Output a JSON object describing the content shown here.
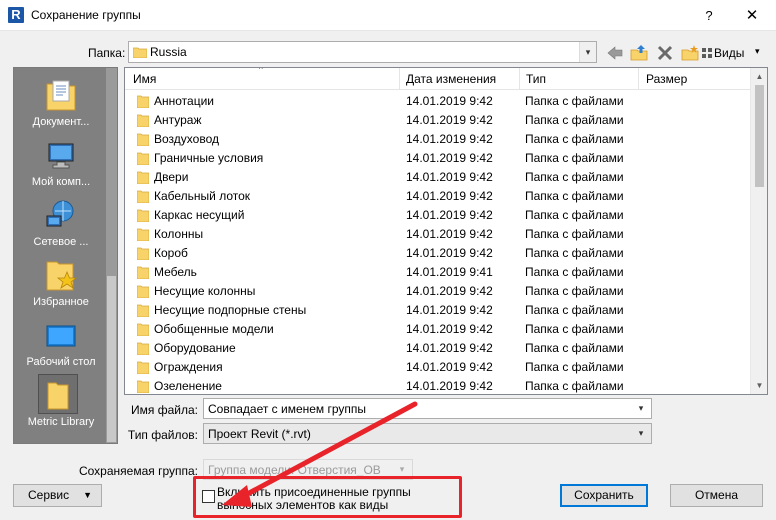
{
  "window": {
    "app_icon_letter": "R",
    "title": "Сохранение группы",
    "help_label": "?",
    "close_label": "✕"
  },
  "toolbar": {
    "folder_label": "Папка:",
    "folder_value": "Russia",
    "views_label": "Виды",
    "icons": [
      "back-arrow-icon",
      "up-folder-icon",
      "delete-icon",
      "new-folder-icon",
      "views-icon"
    ]
  },
  "places": [
    {
      "label": "Документ...",
      "icon": "documents-icon"
    },
    {
      "label": "Мой комп...",
      "icon": "computer-icon"
    },
    {
      "label": "Сетевое ...",
      "icon": "network-icon"
    },
    {
      "label": "Избранное",
      "icon": "favorites-icon"
    },
    {
      "label": "Рабочий стол",
      "icon": "desktop-icon"
    },
    {
      "label": "Metric Library",
      "icon": "library-folder-icon"
    }
  ],
  "columns": {
    "name": "Имя",
    "date": "Дата изменения",
    "type": "Тип",
    "size": "Размер"
  },
  "files": [
    {
      "name": "Аннотации",
      "date": "14.01.2019 9:42",
      "type": "Папка с файлами"
    },
    {
      "name": "Антураж",
      "date": "14.01.2019 9:42",
      "type": "Папка с файлами"
    },
    {
      "name": "Воздуховод",
      "date": "14.01.2019 9:42",
      "type": "Папка с файлами"
    },
    {
      "name": "Граничные условия",
      "date": "14.01.2019 9:42",
      "type": "Папка с файлами"
    },
    {
      "name": "Двери",
      "date": "14.01.2019 9:42",
      "type": "Папка с файлами"
    },
    {
      "name": "Кабельный лоток",
      "date": "14.01.2019 9:42",
      "type": "Папка с файлами"
    },
    {
      "name": "Каркас несущий",
      "date": "14.01.2019 9:42",
      "type": "Папка с файлами"
    },
    {
      "name": "Колонны",
      "date": "14.01.2019 9:42",
      "type": "Папка с файлами"
    },
    {
      "name": "Короб",
      "date": "14.01.2019 9:42",
      "type": "Папка с файлами"
    },
    {
      "name": "Мебель",
      "date": "14.01.2019 9:41",
      "type": "Папка с файлами"
    },
    {
      "name": "Несущие колонны",
      "date": "14.01.2019 9:42",
      "type": "Папка с файлами"
    },
    {
      "name": "Несущие подпорные стены",
      "date": "14.01.2019 9:42",
      "type": "Папка с файлами"
    },
    {
      "name": "Обобщенные модели",
      "date": "14.01.2019 9:42",
      "type": "Папка с файлами"
    },
    {
      "name": "Оборудование",
      "date": "14.01.2019 9:42",
      "type": "Папка с файлами"
    },
    {
      "name": "Ограждения",
      "date": "14.01.2019 9:42",
      "type": "Папка с файлами"
    },
    {
      "name": "Озеленение",
      "date": "14.01.2019 9:42",
      "type": "Папка с файлами"
    }
  ],
  "form": {
    "filename_label": "Имя файла:",
    "filename_value": "Совпадает с именем группы",
    "filetype_label": "Тип файлов:",
    "filetype_value": "Проект Revit  (*.rvt)",
    "group_label": "Сохраняемая группа:",
    "group_value": "Группа модели: Отверстия_ОВ"
  },
  "footer": {
    "service_label": "Сервис",
    "checkbox_label": "Включить присоединенные группы выносных элементов как виды",
    "checkbox_checked": false,
    "save_label": "Сохранить",
    "cancel_label": "Отмена"
  },
  "colors": {
    "highlight": "#e8232a",
    "folder": "#f7d36a",
    "places_bg": "#808080",
    "default_button_border": "#0078d7"
  }
}
